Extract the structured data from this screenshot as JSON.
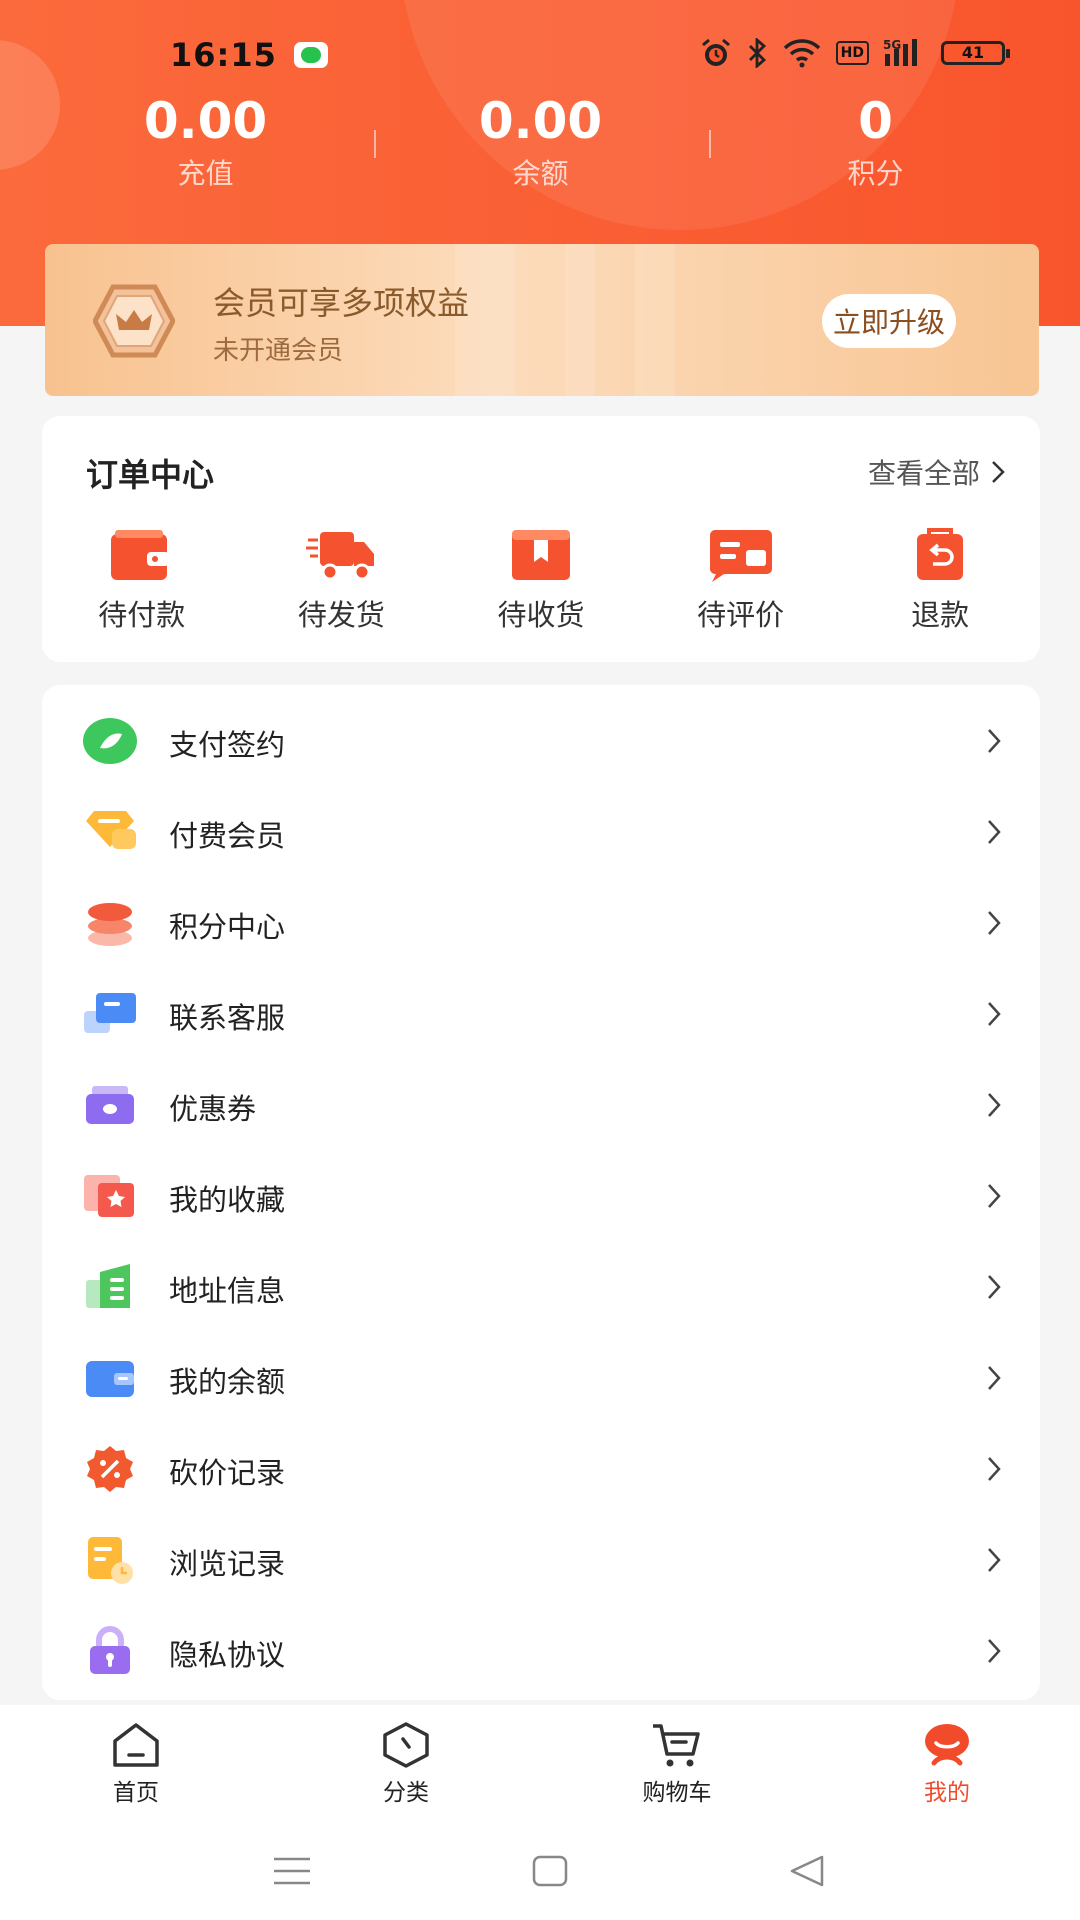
{
  "status_bar": {
    "time": "16:15",
    "signal": "5G",
    "hd": "HD",
    "battery": "41"
  },
  "stats": [
    {
      "value": "0.00",
      "label": "充值"
    },
    {
      "value": "0.00",
      "label": "余额"
    },
    {
      "value": "0",
      "label": "积分"
    }
  ],
  "vip": {
    "title": "会员可享多项权益",
    "subtitle": "未开通会员",
    "button": "立即升级"
  },
  "orders": {
    "title": "订单中心",
    "view_all": "查看全部",
    "items": [
      {
        "label": "待付款",
        "icon": "wallet-icon"
      },
      {
        "label": "待发货",
        "icon": "truck-icon"
      },
      {
        "label": "待收货",
        "icon": "package-icon"
      },
      {
        "label": "待评价",
        "icon": "review-icon"
      },
      {
        "label": "退款",
        "icon": "refund-icon"
      }
    ]
  },
  "menu": [
    {
      "label": "支付签约",
      "icon": "pay-sign-icon",
      "color": "#3ec75d"
    },
    {
      "label": "付费会员",
      "icon": "member-icon",
      "color": "#ffb938"
    },
    {
      "label": "积分中心",
      "icon": "points-icon",
      "color": "#f25a3c"
    },
    {
      "label": "联系客服",
      "icon": "service-icon",
      "color": "#4a8bf5"
    },
    {
      "label": "优惠券",
      "icon": "coupon-icon",
      "color": "#8e6cf0"
    },
    {
      "label": "我的收藏",
      "icon": "favorite-icon",
      "color": "#f5594e"
    },
    {
      "label": "地址信息",
      "icon": "address-icon",
      "color": "#4cc65d"
    },
    {
      "label": "我的余额",
      "icon": "balance-icon",
      "color": "#4a8bf5"
    },
    {
      "label": "砍价记录",
      "icon": "bargain-icon",
      "color": "#f05a2e"
    },
    {
      "label": "浏览记录",
      "icon": "history-icon",
      "color": "#ffb938"
    },
    {
      "label": "隐私协议",
      "icon": "privacy-icon",
      "color": "#9a6cf0"
    }
  ],
  "tabs": [
    {
      "label": "首页",
      "icon": "home-icon"
    },
    {
      "label": "分类",
      "icon": "category-icon"
    },
    {
      "label": "购物车",
      "icon": "cart-icon"
    },
    {
      "label": "我的",
      "icon": "profile-icon",
      "active": true
    }
  ],
  "colors": {
    "primary": "#f9552d",
    "active_tab": "#f24b2b",
    "vip_text": "#8b5a2b"
  }
}
